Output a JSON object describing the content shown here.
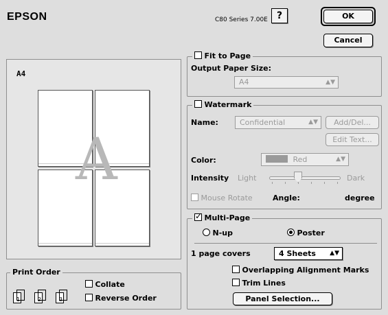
{
  "header": {
    "logo": "EPSON",
    "version": "C80 Series 7.00E",
    "help_label": "?",
    "ok_label": "OK",
    "cancel_label": "Cancel"
  },
  "preview": {
    "paper_label": "A4",
    "watermark_letter": "A"
  },
  "print_order": {
    "title": "Print Order",
    "collate_label": "Collate",
    "reverse_label": "Reverse Order",
    "collate_checked": false,
    "reverse_checked": false,
    "page_numbers": [
      "1",
      "2",
      "3"
    ]
  },
  "fit_to_page": {
    "label": "Fit to Page",
    "checked": false,
    "output_size_label": "Output Paper Size:",
    "output_size_value": "A4"
  },
  "watermark": {
    "label": "Watermark",
    "checked": false,
    "name_label": "Name:",
    "name_value": "Confidential",
    "add_del_label": "Add/Del...",
    "edit_text_label": "Edit Text...",
    "color_label": "Color:",
    "color_value": "Red",
    "color_swatch": "#9a9a9a",
    "intensity_label": "Intensity",
    "light_label": "Light",
    "dark_label": "Dark",
    "intensity_level": 0.35,
    "mouse_rotate_label": "Mouse Rotate",
    "angle_label": "Angle:",
    "degree_label": "degree"
  },
  "multi_page": {
    "label": "Multi-Page",
    "checked": true,
    "nup_label": "N-up",
    "poster_label": "Poster",
    "selected": "Poster",
    "covers_label": "1 page covers",
    "covers_value": "4 Sheets",
    "overlap_label": "Overlapping Alignment Marks",
    "trim_label": "Trim Lines",
    "panel_selection_label": "Panel Selection..."
  }
}
